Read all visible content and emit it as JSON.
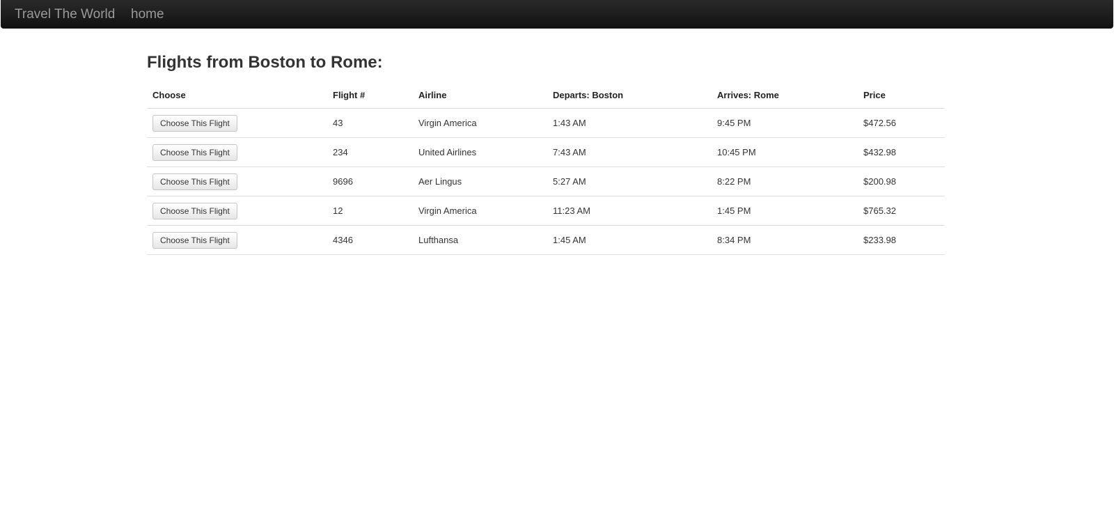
{
  "navbar": {
    "brand": "Travel The World",
    "home": "home"
  },
  "title": "Flights from Boston to Rome:",
  "table": {
    "headers": [
      "Choose",
      "Flight #",
      "Airline",
      "Departs: Boston",
      "Arrives: Rome",
      "Price"
    ],
    "button_label": "Choose This Flight",
    "rows": [
      {
        "flight": "43",
        "airline": "Virgin America",
        "departs": "1:43 AM",
        "arrives": "9:45 PM",
        "price": "$472.56"
      },
      {
        "flight": "234",
        "airline": "United Airlines",
        "departs": "7:43 AM",
        "arrives": "10:45 PM",
        "price": "$432.98"
      },
      {
        "flight": "9696",
        "airline": "Aer Lingus",
        "departs": "5:27 AM",
        "arrives": "8:22 PM",
        "price": "$200.98"
      },
      {
        "flight": "12",
        "airline": "Virgin America",
        "departs": "11:23 AM",
        "arrives": "1:45 PM",
        "price": "$765.32"
      },
      {
        "flight": "4346",
        "airline": "Lufthansa",
        "departs": "1:45 AM",
        "arrives": "8:34 PM",
        "price": "$233.98"
      }
    ]
  }
}
